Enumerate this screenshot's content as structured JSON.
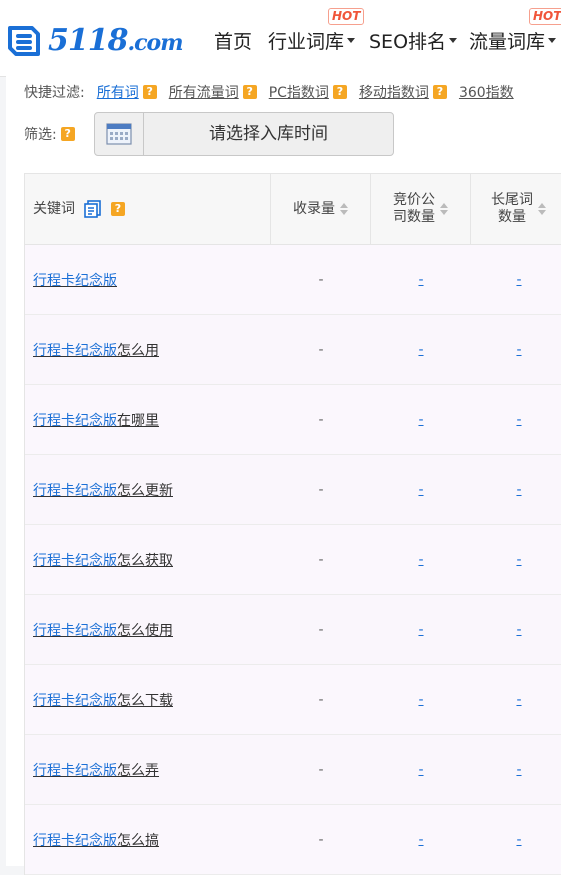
{
  "header": {
    "logo_text": "5118",
    "logo_suffix": ".com",
    "nav": [
      {
        "label": "首页"
      },
      {
        "label": "行业词库",
        "hot": "HOT"
      },
      {
        "label": "SEO排名"
      },
      {
        "label": "流量词库",
        "hot": "HOT"
      }
    ]
  },
  "filters": {
    "label": "快捷过滤:",
    "items": [
      "所有词",
      "所有流量词",
      "PC指数词",
      "移动指数词",
      "360指数"
    ],
    "help": "?"
  },
  "screening": {
    "label": "筛选:",
    "help": "?",
    "date_placeholder": "请选择入库时间"
  },
  "table": {
    "headers": {
      "keyword": "关键词",
      "help": "?",
      "indexed": "收录量",
      "bid_line1": "竞价公",
      "bid_line2": "司数量",
      "longtail_line1": "长尾词",
      "longtail_line2": "数量"
    },
    "rows": [
      {
        "kw_main": "行程卡纪念版",
        "kw_suffix": "",
        "indexed": "-",
        "bid": "-",
        "longtail": "-"
      },
      {
        "kw_main": "行程卡纪念版",
        "kw_suffix": "怎么用",
        "indexed": "-",
        "bid": "-",
        "longtail": "-"
      },
      {
        "kw_main": "行程卡纪念版",
        "kw_suffix": "在哪里",
        "indexed": "-",
        "bid": "-",
        "longtail": "-"
      },
      {
        "kw_main": "行程卡纪念版",
        "kw_suffix": "怎么更新",
        "indexed": "-",
        "bid": "-",
        "longtail": "-"
      },
      {
        "kw_main": "行程卡纪念版",
        "kw_suffix": "怎么获取",
        "indexed": "-",
        "bid": "-",
        "longtail": "-"
      },
      {
        "kw_main": "行程卡纪念版",
        "kw_suffix": "怎么使用",
        "indexed": "-",
        "bid": "-",
        "longtail": "-"
      },
      {
        "kw_main": "行程卡纪念版",
        "kw_suffix": "怎么下载",
        "indexed": "-",
        "bid": "-",
        "longtail": "-"
      },
      {
        "kw_main": "行程卡纪念版",
        "kw_suffix": "怎么弄",
        "indexed": "-",
        "bid": "-",
        "longtail": "-"
      },
      {
        "kw_main": "行程卡纪念版",
        "kw_suffix": "怎么搞",
        "indexed": "-",
        "bid": "-",
        "longtail": "-"
      }
    ]
  },
  "colors": {
    "brand": "#1a6fd6",
    "hot": "#f0553a",
    "help": "#f5a623"
  }
}
